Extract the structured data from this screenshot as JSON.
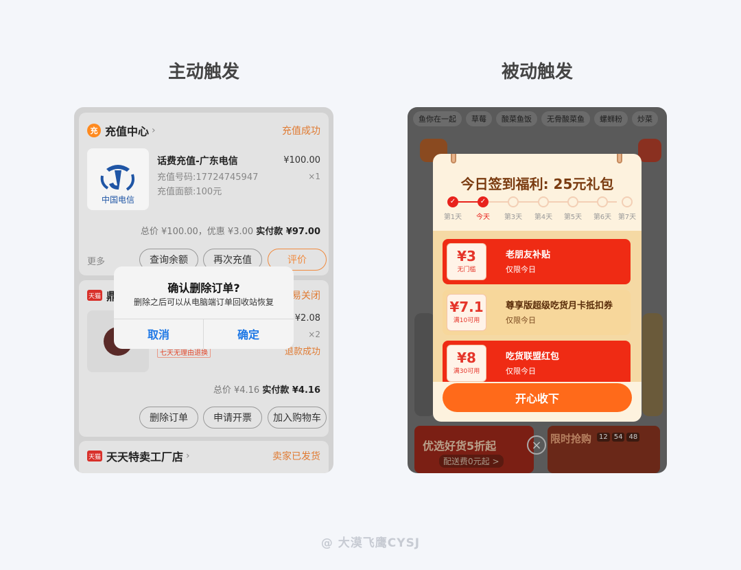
{
  "left_title": "主动触发",
  "right_title": "被动触发",
  "footer": "@ 大漠飞鹰CYSJ",
  "active": {
    "order1": {
      "store_icon": "充",
      "store": "充值中心",
      "status": "充值成功",
      "logo_text": "中国电信",
      "product": "话费充值-广东电信",
      "line1": "充值号码:17724745947",
      "line2": "充值面额:100元",
      "price": "¥100.00",
      "qty": "×1",
      "total_prefix": "总价 ¥100.00，优惠 ¥3.00",
      "paid_label": "实付款 ¥97.00",
      "more": "更多",
      "btn1": "查询余额",
      "btn2": "再次充值",
      "btn3": "评价"
    },
    "order2": {
      "store_icon": "天猫",
      "store": "鼎",
      "status": "易关闭",
      "price": "¥2.08",
      "qty": "×2",
      "refund": "退款成功",
      "tag": "七天无理由退换",
      "total_prefix": "总价 ¥4.16",
      "paid_label": "实付款 ¥4.16",
      "btn1": "删除订单",
      "btn2": "申请开票",
      "btn3": "加入购物车"
    },
    "order3": {
      "store_icon": "天猫",
      "store": "天天特卖工厂店",
      "status": "卖家已发货"
    },
    "dialog": {
      "title": "确认删除订单?",
      "message": "删除之后可以从电脑端订单回收站恢复",
      "cancel": "取消",
      "confirm": "确定"
    }
  },
  "passive": {
    "tags": [
      "鱼你在一起",
      "草莓",
      "酸菜鱼饭",
      "无骨酸菜鱼",
      "螺蛳粉",
      "炒菜"
    ],
    "popup": {
      "title": "今日签到福利: 25元礼包",
      "days": [
        "第1天",
        "今天",
        "第3天",
        "第4天",
        "第5天",
        "第6天",
        "第7天"
      ],
      "coupons": [
        {
          "amount": "¥3",
          "cond": "无门槛",
          "title": "老朋友补贴",
          "sub": "仅限今日"
        },
        {
          "amount": "¥7.1",
          "cond": "满10可用",
          "title": "尊享版超级吃货月卡抵扣券",
          "sub": "仅限今日"
        },
        {
          "amount": "¥8",
          "cond": "满30可用",
          "title": "吃货联盟红包",
          "sub": "仅限今日"
        }
      ],
      "accept": "开心收下"
    },
    "promo_left": {
      "title": "优选好货5折起",
      "sub": "配送费0元起 >"
    },
    "promo_right": {
      "title": "限时抢购",
      "timer": [
        "12",
        "54",
        "48"
      ]
    },
    "colors": {
      "accent_red": "#ef2b14",
      "accept_orange": "#ff6a1a"
    }
  }
}
